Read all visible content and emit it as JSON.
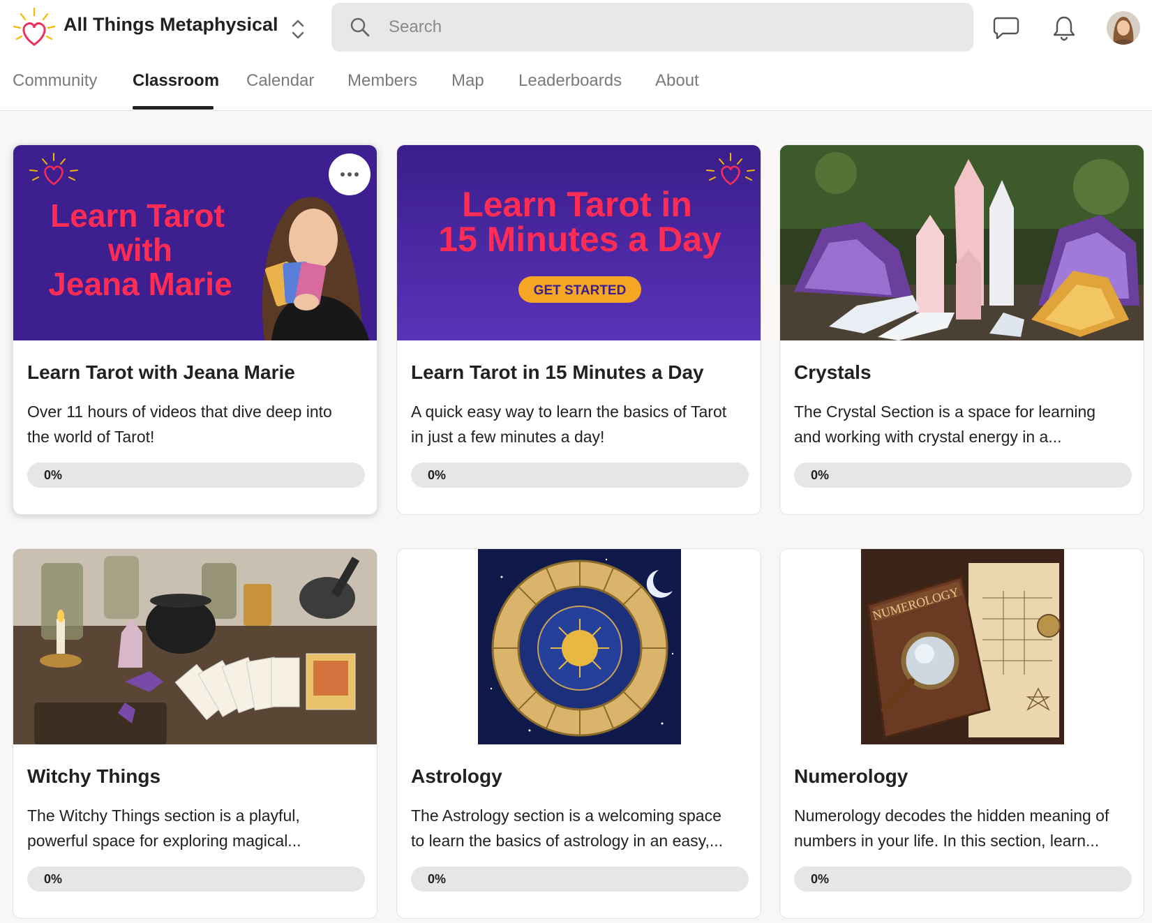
{
  "header": {
    "group_name": "All Things Metaphysical",
    "search_placeholder": "Search",
    "icons": [
      "logo-heart-icon",
      "switcher-chevrons-icon",
      "search-icon",
      "chat-icon",
      "bell-icon",
      "avatar"
    ]
  },
  "tabs": [
    {
      "label": "Community",
      "active": false
    },
    {
      "label": "Classroom",
      "active": true
    },
    {
      "label": "Calendar",
      "active": false
    },
    {
      "label": "Members",
      "active": false
    },
    {
      "label": "Map",
      "active": false
    },
    {
      "label": "Leaderboards",
      "active": false
    },
    {
      "label": "About",
      "active": false
    }
  ],
  "courses": [
    {
      "title": "Learn Tarot with Jeana Marie",
      "desc_lines": [
        "Over 11 hours of videos that dive deep into",
        "the world of Tarot!"
      ],
      "progress": 0,
      "progress_label": "0%",
      "banner_lines": [
        "Learn Tarot",
        "with",
        "Jeana Marie"
      ]
    },
    {
      "title": "Learn Tarot in 15 Minutes a Day",
      "desc_lines": [
        "A quick easy way to learn the basics of Tarot",
        "in just a few minutes a day!"
      ],
      "progress": 0,
      "progress_label": "0%",
      "banner_lines": [
        "Learn Tarot in",
        "15 Minutes a Day"
      ],
      "banner_button": "GET STARTED"
    },
    {
      "title": "Crystals",
      "desc_lines": [
        "The Crystal Section is a space for learning",
        "and working with crystal energy in a..."
      ],
      "progress": 0,
      "progress_label": "0%"
    },
    {
      "title": "Witchy Things",
      "desc_lines": [
        "The Witchy Things section is a playful,",
        "powerful space for exploring magical..."
      ],
      "progress": 0,
      "progress_label": "0%"
    },
    {
      "title": "Astrology",
      "desc_lines": [
        "The Astrology section is a welcoming space",
        "to learn the basics of astrology in an easy,..."
      ],
      "progress": 0,
      "progress_label": "0%"
    },
    {
      "title": "Numerology",
      "desc_lines": [
        "Numerology decodes the hidden meaning of",
        "numbers in your life. In this section, learn..."
      ],
      "progress": 0,
      "progress_label": "0%",
      "banner_lines": [
        "NUMEROLOGY"
      ]
    }
  ],
  "colors": {
    "banner_purple": "#3d1f8f",
    "banner_text_red": "#ff2d55",
    "cta_orange": "#f5a623",
    "active_tab": "#202124",
    "inactive_tab": "#7a7a7a"
  }
}
